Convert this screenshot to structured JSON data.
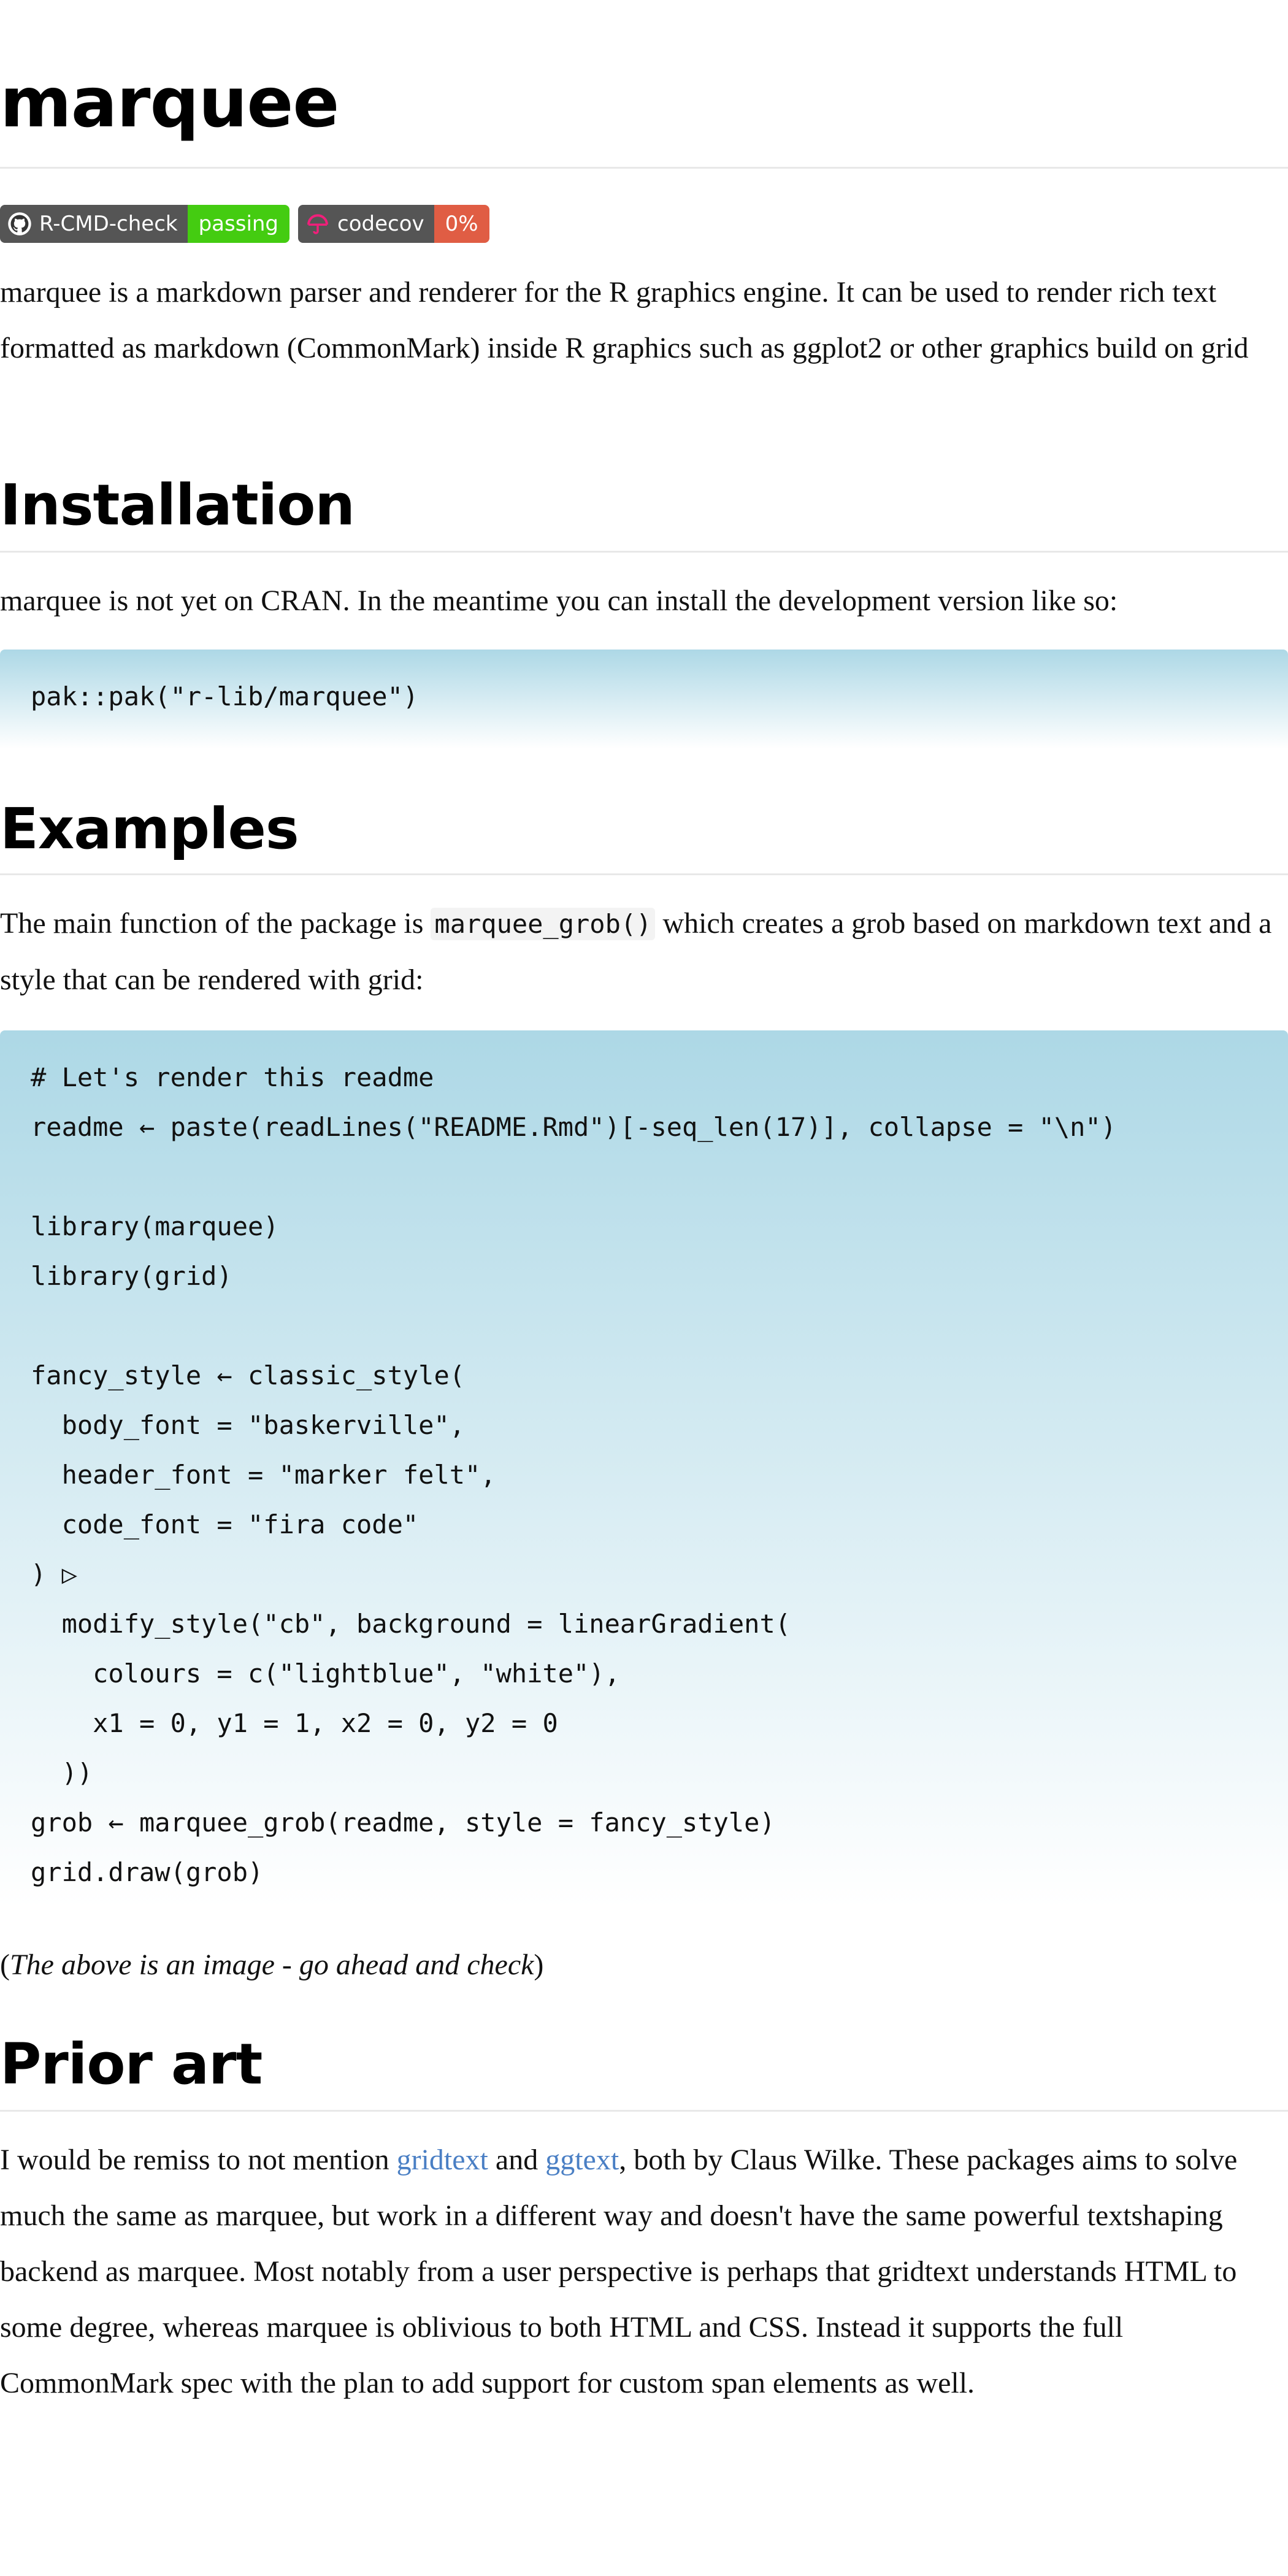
{
  "title": "marquee",
  "badges": [
    {
      "label": "R-CMD-check",
      "status": "passing",
      "status_color": "#44cc11",
      "icon": "github-icon"
    },
    {
      "label": "codecov",
      "status": "0%",
      "status_color": "#e05d44",
      "icon": "codecov-umbrella-icon"
    }
  ],
  "intro": "marquee is a markdown parser and renderer for the R graphics engine. It can be used to render rich text formatted as markdown (CommonMark) inside R graphics such as ggplot2 or other graphics build on grid",
  "installation": {
    "heading": "Installation",
    "text": "marquee is not yet on CRAN. In the meantime you can install the development version like so:",
    "code": [
      "pak::pak(\"r-lib/marquee\")"
    ]
  },
  "examples": {
    "heading": "Examples",
    "text_before": "The main function of the package is",
    "inline_code": "marquee_grob()",
    "text_after": "which creates a grob based on markdown text and a style that can be rendered with grid:",
    "code": [
      "# Let's render this readme",
      "readme ← paste(readLines(\"README.Rmd\")[-seq_len(17)], collapse = \"\\n\")",
      "",
      "library(marquee)",
      "library(grid)",
      "",
      "fancy_style ← classic_style(",
      "  body_font = \"baskerville\",",
      "  header_font = \"marker felt\",",
      "  code_font = \"fira code\"",
      ") ▷",
      "  modify_style(\"cb\", background = linearGradient(",
      "    colours = c(\"lightblue\", \"white\"),",
      "    x1 = 0, y1 = 1, x2 = 0, y2 = 0",
      "  ))",
      "grob ← marquee_grob(readme, style = fancy_style)",
      "grid.draw(grob)"
    ],
    "note_open": "(",
    "note_italic": "The above is an image - go ahead and check",
    "note_close": ")"
  },
  "prior_art": {
    "heading": "Prior art",
    "text_start": "I would be remiss to not mention",
    "link1": "gridtext",
    "text_and": "and",
    "link2": "ggtext",
    "text_rest": ", both by Claus Wilke. These packages aims to solve much the same as marquee, but work in a different way and doesn't have the same powerful textshaping backend as marquee. Most notably from a user perspective is perhaps that gridtext understands HTML to some degree, whereas marquee is oblivious to both HTML and CSS. Instead it supports the full CommonMark spec with the plan to add support for custom span elements as well."
  },
  "colors": {
    "link": "#4a7fc4",
    "code_gradient_top": "#add8e6",
    "code_gradient_bottom": "#ffffff",
    "badge_label_bg": "#555555"
  }
}
